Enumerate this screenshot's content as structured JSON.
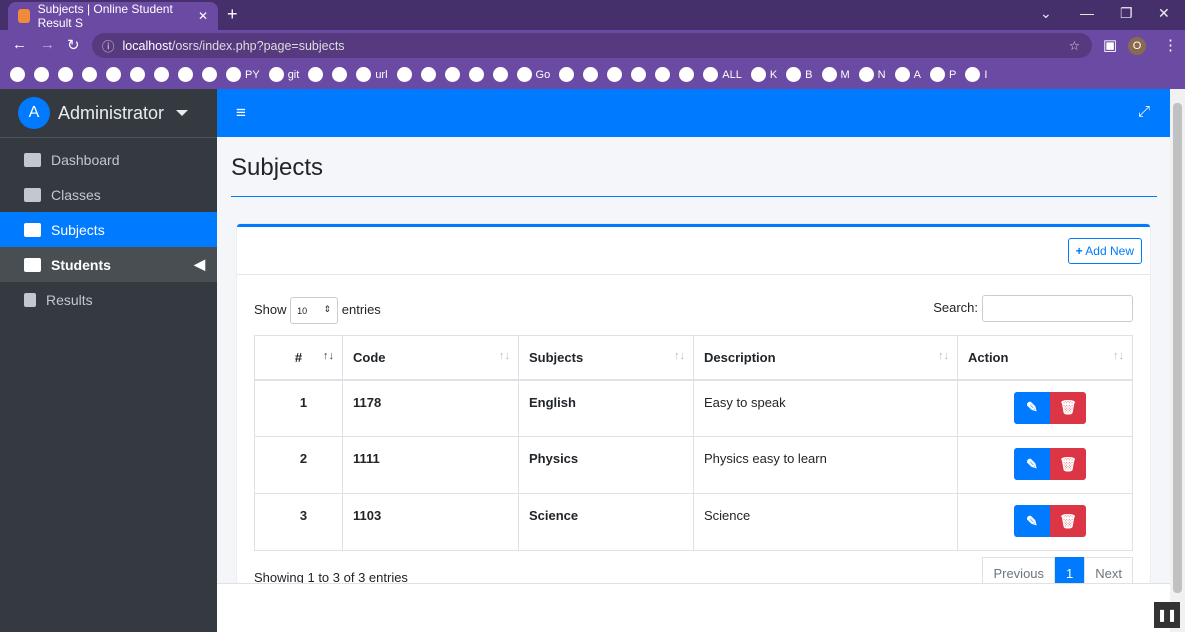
{
  "browser": {
    "tab_title": "Subjects | Online Student Result S",
    "url_host": "localhost",
    "url_path": "/osrs/index.php?page=subjects",
    "profile": "O",
    "bookmarks": [
      "",
      "",
      "",
      "",
      "",
      "",
      "",
      "",
      "",
      "PY",
      "git",
      "",
      "",
      "url",
      "",
      "",
      "",
      "",
      "",
      "Go",
      "",
      "",
      "",
      "",
      "",
      "",
      "ALL",
      "K",
      "B",
      "M",
      "N",
      "A",
      "P",
      "I"
    ]
  },
  "sidebar": {
    "user": "Administrator",
    "avatar": "A",
    "items": [
      {
        "label": "Dashboard"
      },
      {
        "label": "Classes"
      },
      {
        "label": "Subjects"
      },
      {
        "label": "Students"
      },
      {
        "label": "Results"
      }
    ]
  },
  "page": {
    "title": "Subjects",
    "add_new": "Add New",
    "show": "Show",
    "entries": "entries",
    "page_size": "10",
    "search_label": "Search:",
    "columns": [
      "#",
      "Code",
      "Subjects",
      "Description",
      "Action"
    ],
    "rows": [
      {
        "n": "1",
        "code": "1178",
        "subject": "English",
        "desc": "Easy to speak"
      },
      {
        "n": "2",
        "code": "1111",
        "subject": "Physics",
        "desc": "Physics easy to learn"
      },
      {
        "n": "3",
        "code": "1103",
        "subject": "Science",
        "desc": "Science"
      }
    ],
    "info": "Showing 1 to 3 of 3 entries",
    "prev": "Previous",
    "current": "1",
    "next": "Next"
  },
  "colors": {
    "primary": "#007bff",
    "danger": "#dc3545",
    "sidebar": "#343a40",
    "browser": "#6b4aa3"
  }
}
